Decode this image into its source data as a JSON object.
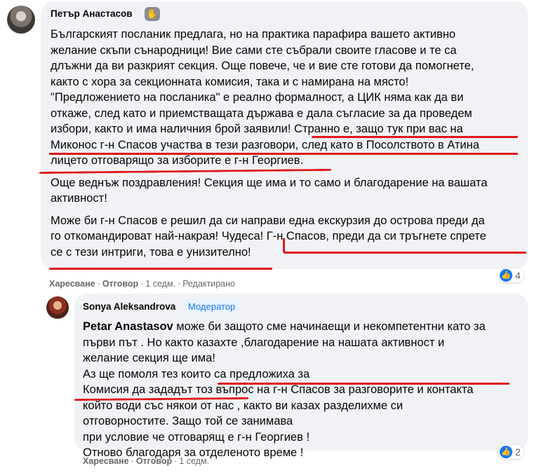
{
  "comments": [
    {
      "author": "Петър Анастасов",
      "author_icon": "wave-icon",
      "paragraphs": [
        {
          "lines": [
            "Българският посланик предлага, но на практика парафира вашето активно",
            "желание скъпи сънародници! Вие сами сте събрали своите гласове и те са",
            "длъжни да ви разкрият секция. Още повече, че и вие сте готови да помогнете,",
            "както с хора за секционната комисия, така и с намирана на място!",
            "\"Предложението на посланика\" е реално формалност, а ЦИК няма как да ви",
            "откаже, след като и приемстващата държава е дала съгласие за да проведем",
            "избори, както и има наличния брой заявили! Странно е, защо тук при вас на",
            "Миконос г-н Спасов участва в тези разговори, след като в Посолството в Атина",
            "лицето отговарящо за изборите е г-н Георгиев."
          ]
        },
        {
          "lines": [
            "Още веднъж поздравления! Секция ще има и то само и благодарение на вашата",
            "активност!"
          ]
        },
        {
          "lines": [
            "Може би г-н Спасов е решил да си направи една екскурзия до острова преди да",
            "го откомандироват най-накрая! Чудеса! Г-н Спасов, преди да си тръгнете спрете",
            "се с тези интриги, това е унизително!"
          ]
        }
      ],
      "reaction_count": "4",
      "actions": {
        "like": "Харесване",
        "reply": "Отговор",
        "time": "1 седм.",
        "edited": "Редактирано",
        "separator": "·"
      }
    },
    {
      "author": "Sonya Aleksandrova",
      "badge": "Модератор",
      "mention": "Petar Anastasov",
      "paragraphs": [
        {
          "lines": [
            " може би защото сме начинаещи и некомпетентни като за",
            "първи път . Но както казахте ,благодарение на нашата активност и",
            "желание секция ще има!",
            "Аз ще помоля тез които са предложиха за",
            "Комисия да зададът тоз въпрос на г-н Спасов за разговорите и контакта",
            "който води със някои от нас , както ви казах разделихме си",
            "отговорностите. Защо той се занимава",
            "при условие че отговарящ е г-н Георгиев !",
            "Отново благодаря за отделеното време !"
          ]
        }
      ],
      "reaction_count": "2",
      "actions": {
        "like": "Харесване",
        "reply": "Отговор",
        "time": "1 седм.",
        "separator": "·"
      }
    }
  ],
  "colors": {
    "bubble": "#f0f2f5",
    "text": "#050505",
    "meta": "#65676b",
    "like_blue": "#1877f2",
    "annotation_red": "#e0161b"
  }
}
